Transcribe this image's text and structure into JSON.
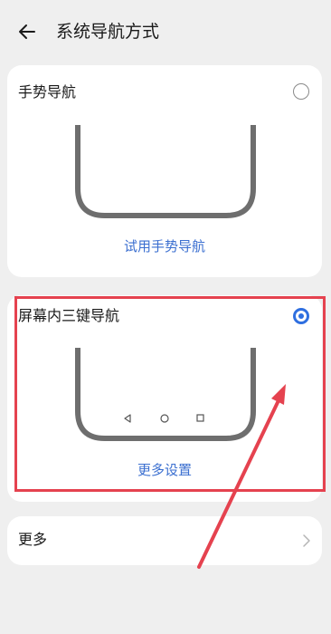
{
  "header": {
    "title": "系统导航方式"
  },
  "options": [
    {
      "label": "手势导航",
      "action": "试用手势导航",
      "selected": false
    },
    {
      "label": "屏幕内三键导航",
      "action": "更多设置",
      "selected": true
    }
  ],
  "more": {
    "label": "更多"
  },
  "colors": {
    "accent": "#2f6fe0",
    "link": "#3b6fd0",
    "annotation": "#e5424f",
    "background": "#efefef"
  },
  "icons": {
    "back": "arrow-left",
    "more": "chevron-right",
    "nav_buttons": [
      "triangle-back",
      "circle-home",
      "square-recents"
    ]
  }
}
